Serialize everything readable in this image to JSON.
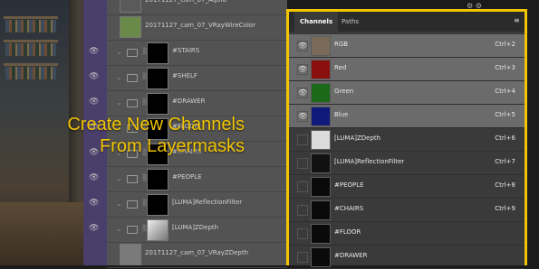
{
  "overlay": {
    "line1": "Create New Channels",
    "line2": "From Layermasks",
    "color": "#f2c500"
  },
  "layers": {
    "rows": [
      {
        "name": "20171127_cam_07_Alpha",
        "type": "image"
      },
      {
        "name": "20171127_cam_07_VRayWireColor",
        "type": "image"
      },
      {
        "name": "#STAIRS",
        "type": "mask"
      },
      {
        "name": "#SHELF",
        "type": "mask"
      },
      {
        "name": "#DRAWER",
        "type": "mask"
      },
      {
        "name": "#FLOOR",
        "type": "mask"
      },
      {
        "name": "#CHAIRS",
        "type": "mask"
      },
      {
        "name": "#PEOPLE",
        "type": "mask"
      },
      {
        "name": "[LUMA]ReflectionFilter",
        "type": "mask"
      },
      {
        "name": "[LUMA]ZDepth",
        "type": "mask"
      },
      {
        "name": "20171127_cam_07_VRayZDepth",
        "type": "image"
      }
    ]
  },
  "channels": {
    "tabs": [
      "Channels",
      "Paths"
    ],
    "active_tab": "Channels",
    "menu_icon": "panel-menu-icon",
    "items": [
      {
        "name": "RGB",
        "shortcut": "Ctrl+2",
        "selected": true,
        "visible": true,
        "thumb_color": "#7a6a5a"
      },
      {
        "name": "Red",
        "shortcut": "Ctrl+3",
        "selected": true,
        "visible": true,
        "thumb_color": "#8a1010"
      },
      {
        "name": "Green",
        "shortcut": "Ctrl+4",
        "selected": true,
        "visible": true,
        "thumb_color": "#1a6a1a"
      },
      {
        "name": "Blue",
        "shortcut": "Ctrl+5",
        "selected": true,
        "visible": true,
        "thumb_color": "#101a7a"
      },
      {
        "name": "[LUMA]ZDepth",
        "shortcut": "Ctrl+6",
        "selected": false,
        "visible": false,
        "thumb_color": "#dcdcdc"
      },
      {
        "name": "[LUMA]ReflectionFilter",
        "shortcut": "Ctrl+7",
        "selected": false,
        "visible": false,
        "thumb_color": "#111111"
      },
      {
        "name": "#PEOPLE",
        "shortcut": "Ctrl+8",
        "selected": false,
        "visible": false,
        "thumb_color": "#0a0a0a"
      },
      {
        "name": "#CHAIRS",
        "shortcut": "Ctrl+9",
        "selected": false,
        "visible": false,
        "thumb_color": "#0a0a0a"
      },
      {
        "name": "#FLOOR",
        "shortcut": "",
        "selected": false,
        "visible": false,
        "thumb_color": "#0a0a0a"
      },
      {
        "name": "#DRAWER",
        "shortcut": "",
        "selected": false,
        "visible": false,
        "thumb_color": "#0a0a0a"
      }
    ]
  }
}
